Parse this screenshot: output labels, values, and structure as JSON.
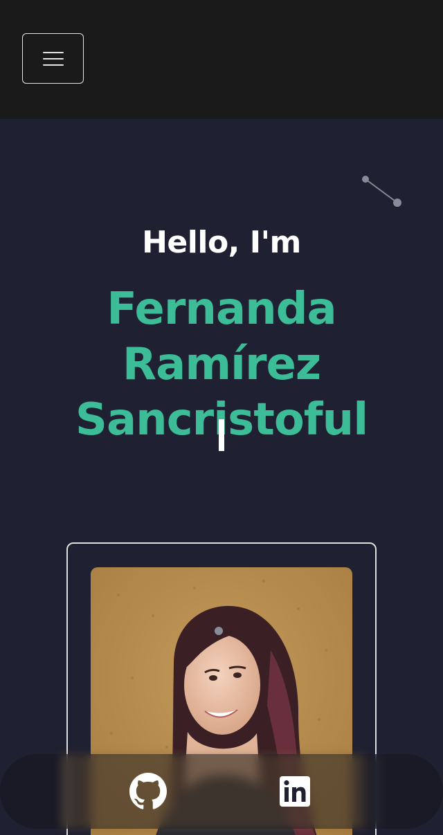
{
  "header": {
    "menu_icon": "hamburger-menu-icon"
  },
  "hero": {
    "greeting": "Hello, I'm",
    "name_lines": [
      "Fernanda",
      "Ramírez",
      "Sancristoful"
    ],
    "cursor_char": "|"
  },
  "profile": {
    "photo_alt": "Profile photo"
  },
  "social": {
    "links": [
      {
        "icon": "github-icon"
      },
      {
        "icon": "linkedin-icon"
      }
    ]
  },
  "colors": {
    "topbar": "#1a1a1a",
    "background": "#1f2031",
    "accent": "#3cbc97",
    "text": "#ffffff"
  }
}
